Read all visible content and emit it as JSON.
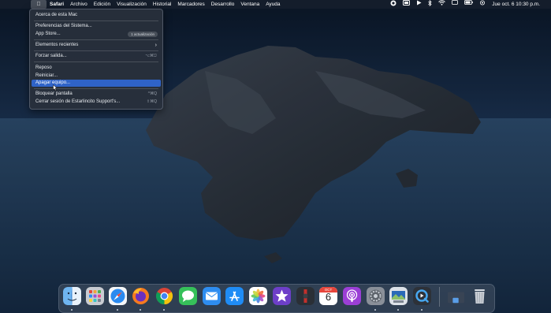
{
  "menubar": {
    "apple_icon": "apple-logo",
    "items": [
      "Safari",
      "Archivo",
      "Edición",
      "Visualización",
      "Historial",
      "Marcadores",
      "Desarrollo",
      "Ventana",
      "Ayuda"
    ],
    "clock": "Jue oct. 6  10:30 p.m."
  },
  "apple_menu": {
    "items": [
      {
        "label": "Acerca de esta Mac"
      },
      {
        "label": "Preferencias del Sistema..."
      },
      {
        "label": "App Store...",
        "badge": "1 actualización"
      },
      {
        "label": "Elementos recientes"
      },
      {
        "label": "Forzar salida...",
        "shortcut": "⌥⌘⎋"
      },
      {
        "label": "Reposo"
      },
      {
        "label": "Reiniciar..."
      },
      {
        "label": "Apagar equipo..."
      },
      {
        "label": "Bloquear pantalla",
        "shortcut": "^⌘Q"
      },
      {
        "label": "Cerrar sesión de Estarlincito Support's...",
        "shortcut": "⇧⌘Q"
      }
    ],
    "highlighted": "Apagar equipo..."
  },
  "dock": {
    "apps": [
      "finder-icon",
      "launchpad-icon",
      "safari-icon",
      "firefox-icon",
      "chrome-icon",
      "messages-icon",
      "mail-icon",
      "app-store-icon",
      "photos-icon",
      "imovie-icon",
      "photo-booth-icon",
      "calendar-icon",
      "podcasts-icon",
      "system-preferences-icon",
      "preview-icon",
      "quicktime-icon",
      "downloads-folder-icon",
      "trash-icon"
    ],
    "calendar_month": "OCT",
    "calendar_day": "6"
  },
  "colors": {
    "highlight": "#2f63c8",
    "menu_bg": "#283040",
    "menubar_bg": "#161e2c"
  }
}
